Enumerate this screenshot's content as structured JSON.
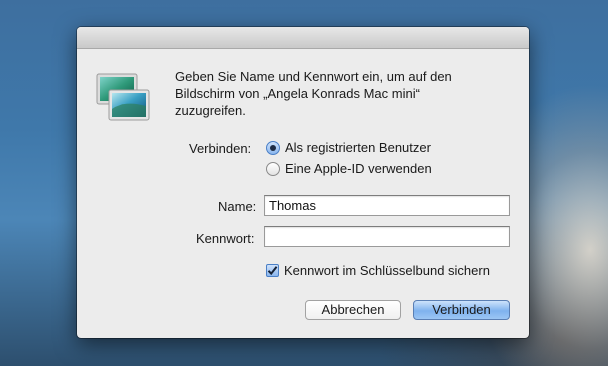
{
  "dialog": {
    "message_lines": [
      "Geben Sie Name und Kennwort ein, um auf den",
      "Bildschirm von „Angela Konrads Mac mini“",
      "zuzugreifen."
    ],
    "app_icon": "screen-sharing-icon"
  },
  "connect": {
    "label": "Verbinden:",
    "options": [
      {
        "label": "Als registrierten Benutzer",
        "selected": true
      },
      {
        "label": "Eine Apple-ID verwenden",
        "selected": false
      }
    ]
  },
  "fields": {
    "name_label": "Name:",
    "name_value": "Thomas",
    "password_label": "Kennwort:",
    "password_value": ""
  },
  "keychain": {
    "label": "Kennwort im Schlüsselbund sichern",
    "checked": true
  },
  "buttons": {
    "cancel": "Abbrechen",
    "connect": "Verbinden"
  },
  "colors": {
    "accent": "#7fb2ee",
    "dialog_bg": "#ececec"
  }
}
